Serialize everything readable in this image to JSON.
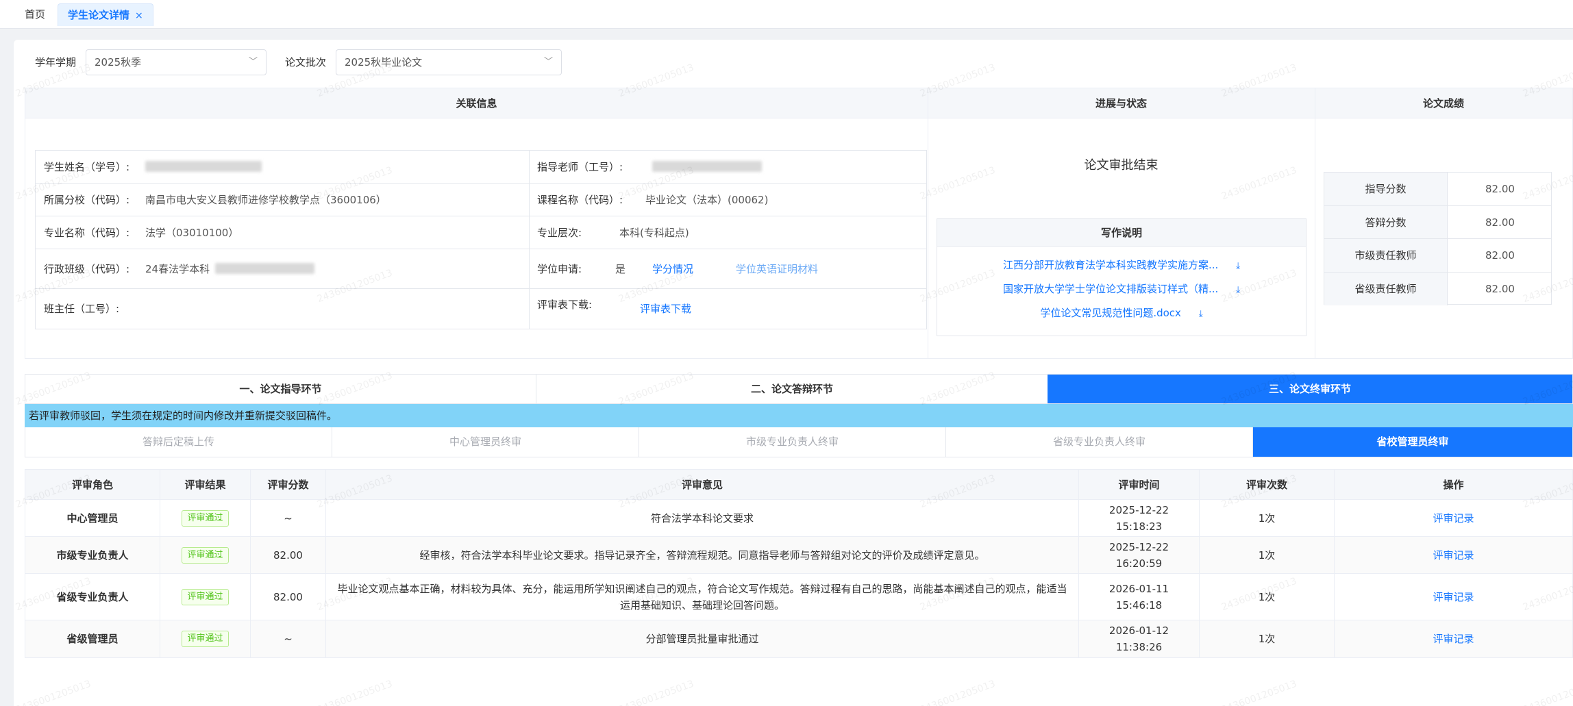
{
  "tabs": [
    {
      "label": "首页"
    },
    {
      "label": "学生论文详情",
      "close": "×"
    }
  ],
  "filters": {
    "term_label": "学年学期",
    "term_value": "2025秋季",
    "batch_label": "论文批次",
    "batch_value": "2025秋毕业论文"
  },
  "sections": {
    "related": "关联信息",
    "progress": "进展与状态",
    "score": "论文成绩"
  },
  "related": {
    "student_label": "学生姓名（学号）:",
    "student_value_partial": "2…205013)",
    "advisor_label": "指导老师（工号）:",
    "branch_label": "所属分校（代码）:",
    "branch_value": "南昌市电大安义县教师进修学校教学点（3600106）",
    "course_label": "课程名称（代码）:",
    "course_value": "毕业论文（法本）(00062)",
    "major_label": "专业名称（代码）:",
    "major_value": "法学（03010100）",
    "level_label": "专业层次:",
    "level_value": "本科(专科起点)",
    "class_label": "行政班级（代码）:",
    "class_value": "24春法学本科",
    "degree_label": "学位申请:",
    "degree_value": "是",
    "credit_link": "学分情况",
    "english_link": "学位英语证明材料",
    "headteacher_label": "班主任（工号）:",
    "review_dl_label": "评审表下载:",
    "review_dl_link": "评审表下载"
  },
  "progress": {
    "status": "论文审批结束",
    "writing_title": "写作说明",
    "docs": [
      {
        "name": "江西分部开放教育法学本科实践教学实施方案..."
      },
      {
        "name": "国家开放大学学士学位论文排版装订样式（精..."
      },
      {
        "name": "学位论文常见规范性问题.docx"
      }
    ],
    "download_icon": "download-icon"
  },
  "scores": [
    {
      "label": "指导分数",
      "value": "82.00"
    },
    {
      "label": "答辩分数",
      "value": "82.00"
    },
    {
      "label": "市级责任教师",
      "value": "82.00"
    },
    {
      "label": "省级责任教师",
      "value": "82.00"
    }
  ],
  "steps": [
    {
      "label": "一、论文指导环节",
      "active": false
    },
    {
      "label": "二、论文答辩环节",
      "active": false
    },
    {
      "label": "三、论文终审环节",
      "active": true
    }
  ],
  "notice": "若评审教师驳回，学生须在规定的时间内修改并重新提交驳回稿件。",
  "substeps": [
    {
      "label": "答辩后定稿上传",
      "active": false
    },
    {
      "label": "中心管理员终审",
      "active": false
    },
    {
      "label": "市级专业负责人终审",
      "active": false
    },
    {
      "label": "省级专业负责人终审",
      "active": false
    },
    {
      "label": "省校管理员终审",
      "active": true
    }
  ],
  "review_table": {
    "headers": [
      "评审角色",
      "评审结果",
      "评审分数",
      "评审意见",
      "评审时间",
      "评审次数",
      "操作"
    ],
    "rows": [
      {
        "role": "中心管理员",
        "result": "评审通过",
        "score": "~",
        "opinion": "符合法学本科论文要求",
        "time": "2025-12-22 15:18:23",
        "count": "1次",
        "action": "评审记录"
      },
      {
        "role": "市级专业负责人",
        "result": "评审通过",
        "score": "82.00",
        "opinion": "经审核，符合法学本科毕业论文要求。指导记录齐全，答辩流程规范。同意指导老师与答辩组对论文的评价及成绩评定意见。",
        "time": "2025-12-22 16:20:59",
        "count": "1次",
        "action": "评审记录"
      },
      {
        "role": "省级专业负责人",
        "result": "评审通过",
        "score": "82.00",
        "opinion": "毕业论文观点基本正确，材料较为具体、充分，能运用所学知识阐述自己的观点，符合论文写作规范。答辩过程有自己的思路，尚能基本阐述自己的观点，能适当运用基础知识、基础理论回答问题。",
        "time": "2026-01-11 15:46:18",
        "count": "1次",
        "action": "评审记录"
      },
      {
        "role": "省级管理员",
        "result": "评审通过",
        "score": "~",
        "opinion": "分部管理员批量审批通过",
        "time": "2026-01-12 11:38:26",
        "count": "1次",
        "action": "评审记录"
      }
    ]
  },
  "watermark": "2436001205013"
}
